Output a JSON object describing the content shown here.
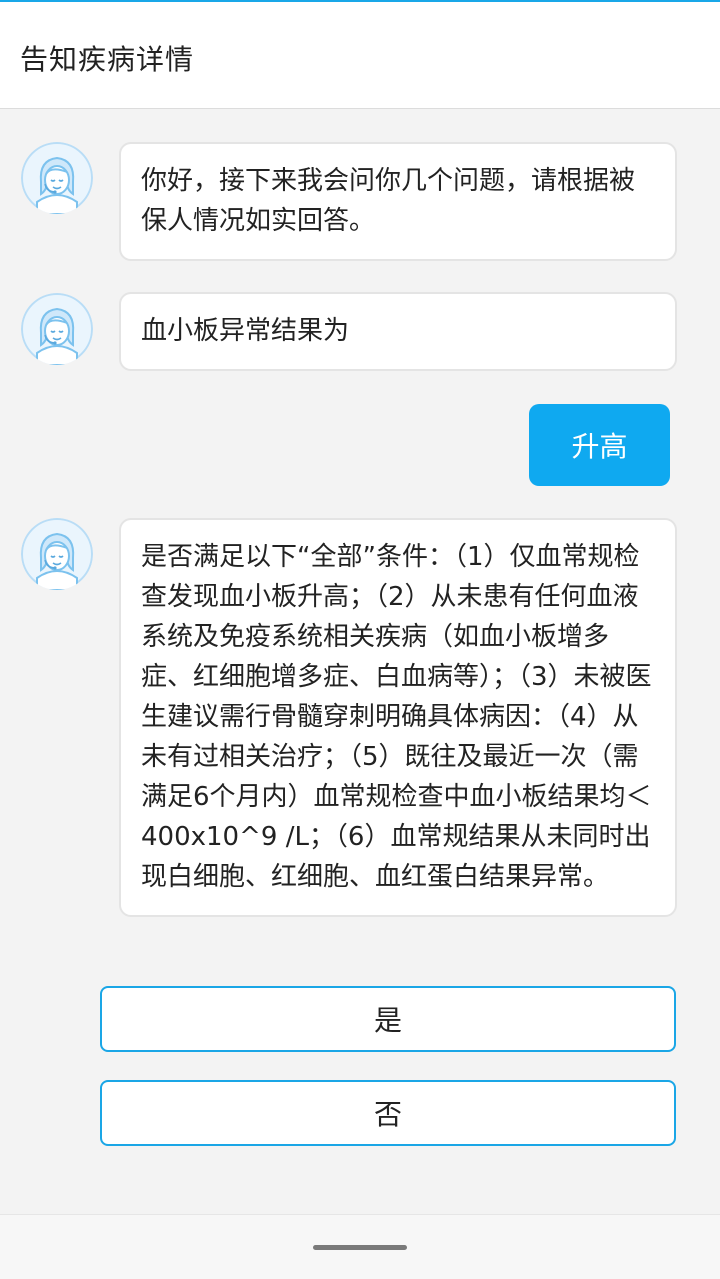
{
  "header": {
    "title": "告知疾病详情"
  },
  "chat": {
    "messages": [
      {
        "text": "你好，接下来我会问你几个问题，请根据被保人情况如实回答。"
      },
      {
        "text": "血小板异常结果为"
      },
      {
        "text": "是否满足以下“全部”条件：（1）仅血常规检查发现血小板升高；（2）从未患有任何血液系统及免疫系统相关疾病（如血小板增多症、红细胞增多症、白血病等）；（3）未被医生建议需行骨髓穿刺明确具体病因：（4）从未有过相关治疗；（5）既往及最近一次（需满足6个月内）血常规检查中血小板结果均＜400x10^9 /L；（6）血常规结果从未同时出现白细胞、红细胞、血红蛋白结果异常。"
      }
    ],
    "user_answer": "升高"
  },
  "options": {
    "yes": "是",
    "no": "否"
  },
  "colors": {
    "accent": "#0fa9f0",
    "option_border": "#1aa6e6",
    "background": "#f3f3f3"
  }
}
